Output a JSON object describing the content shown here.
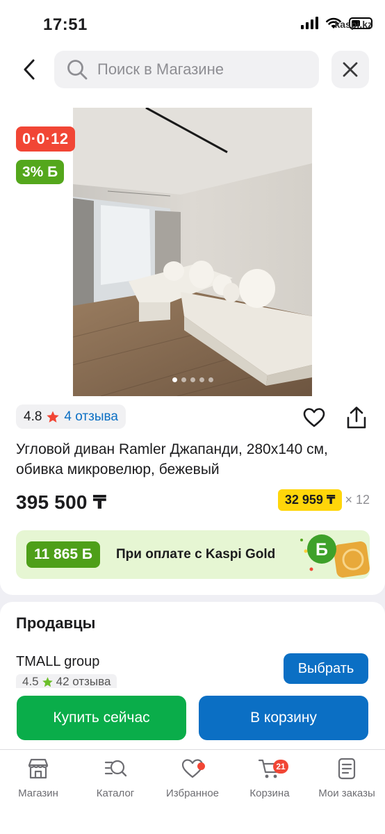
{
  "status_bar": {
    "time": "17:51",
    "carrier": "kaspi.kz"
  },
  "header": {
    "search_placeholder": "Поиск в Магазине"
  },
  "product": {
    "installment_badge": "0·0·12",
    "bonus_badge": "3% Б",
    "image_count": 5,
    "active_image": 1,
    "rating": "4.8",
    "reviews_link": "4 отзыва",
    "title": "Угловой диван Ramler Джапанди, 280x140 см, обивка микровелюр, бежевый",
    "price": "395 500 ₸",
    "monthly_price": "32 959 ₸",
    "monthly_term": "× 12"
  },
  "kaspi_gold": {
    "amount": "11 865 Б",
    "text": "При оплате с Kaspi Gold"
  },
  "sellers": {
    "title": "Продавцы",
    "items": [
      {
        "name": "TMALL group",
        "rating": "4.5",
        "reviews": "42 отзыва",
        "button": "Выбрать"
      }
    ]
  },
  "actions": {
    "buy_now": "Купить сейчас",
    "add_to_cart": "В корзину"
  },
  "tab_bar": {
    "items": [
      {
        "label": "Магазин",
        "icon": "store-icon"
      },
      {
        "label": "Каталог",
        "icon": "catalog-search-icon"
      },
      {
        "label": "Избранное",
        "icon": "heart-icon",
        "dot": true
      },
      {
        "label": "Корзина",
        "icon": "cart-icon",
        "badge": "21"
      },
      {
        "label": "Мои заказы",
        "icon": "orders-icon"
      }
    ]
  },
  "colors": {
    "kaspi_red": "#f14635",
    "kaspi_blue": "#0b6fc4",
    "buy_green": "#0aad4a",
    "bonus_green": "#54a71c",
    "installment_yellow": "#ffd60a"
  }
}
